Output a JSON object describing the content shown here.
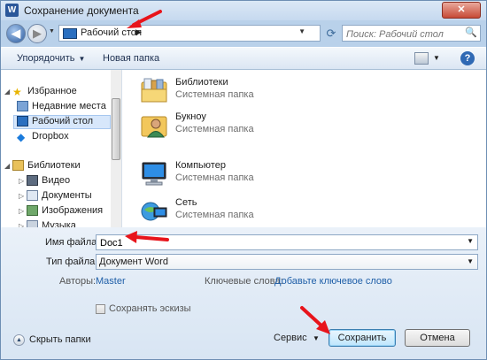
{
  "window": {
    "title": "Сохранение документа",
    "app_icon_letter": "W",
    "close_label": "✕"
  },
  "nav": {
    "address_crumb": "Рабочий стол",
    "search_placeholder": "Поиск: Рабочий стол"
  },
  "toolbar": {
    "organize_label": "Упорядочить",
    "new_folder_label": "Новая папка",
    "help_label": "?"
  },
  "sidebar": {
    "items": [
      {
        "label": "Избранное"
      },
      {
        "label": "Недавние места"
      },
      {
        "label": "Рабочий стол"
      },
      {
        "label": "Dropbox"
      },
      {
        "label": "Библиотеки"
      },
      {
        "label": "Видео"
      },
      {
        "label": "Документы"
      },
      {
        "label": "Изображения"
      },
      {
        "label": "Музыка"
      }
    ]
  },
  "files": [
    {
      "name": "Библиотеки",
      "type": "Системная папка",
      "icon": "libraries-folder-icon"
    },
    {
      "name": "Букноу",
      "type": "Системная папка",
      "icon": "user-folder-icon"
    },
    {
      "name": "Компьютер",
      "type": "Системная папка",
      "icon": "computer-icon"
    },
    {
      "name": "Сеть",
      "type": "Системная папка",
      "icon": "network-icon"
    }
  ],
  "form": {
    "filename_label": "Имя файла:",
    "filename_value": "Doc1",
    "filetype_label": "Тип файла:",
    "filetype_value": "Документ Word",
    "authors_label": "Авторы:",
    "authors_value": "Master",
    "keywords_label": "Ключевые слова:",
    "keywords_value": "Добавьте ключевое слово",
    "thumbnails_label": "Сохранять эскизы"
  },
  "footer": {
    "hide_folders_label": "Скрыть папки",
    "service_label": "Сервис",
    "save_label": "Сохранить",
    "cancel_label": "Отмена"
  },
  "colors": {
    "annotation_arrow": "#e8141b",
    "title_bar": "#c6d9ef"
  }
}
